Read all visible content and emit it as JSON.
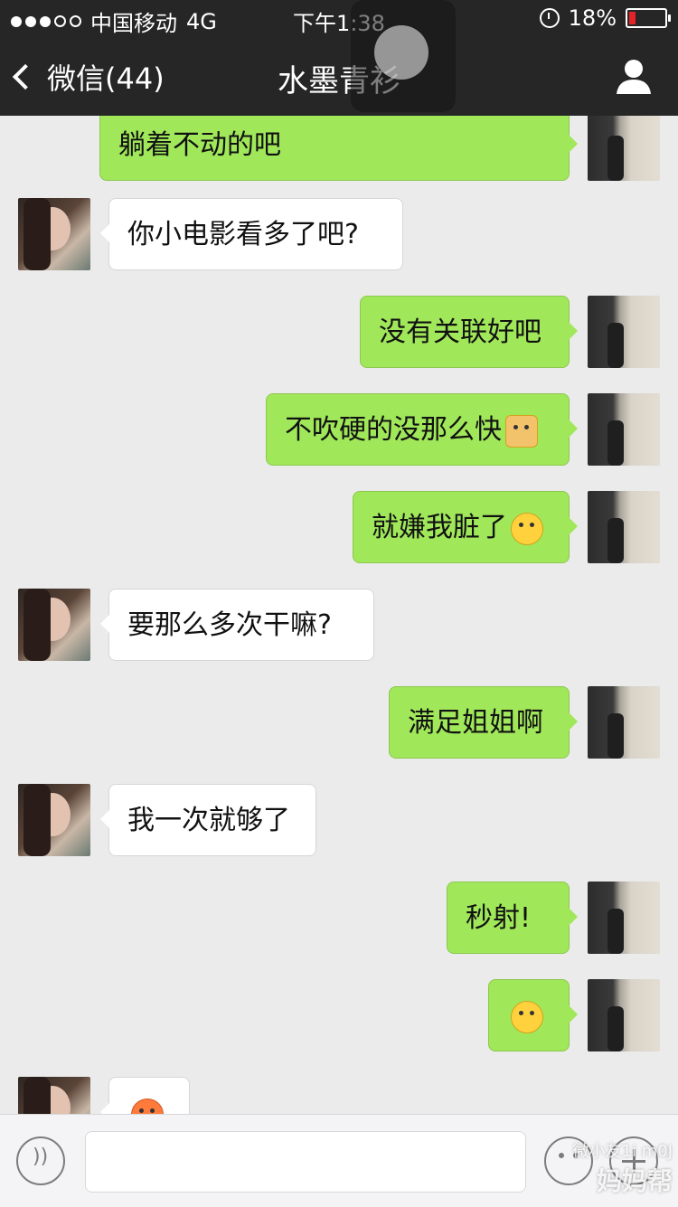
{
  "status_bar": {
    "carrier": "中国移动",
    "network": "4G",
    "time": "下午1:38",
    "battery": "18%",
    "battery_level": 0.18,
    "battery_color": "#e5212a"
  },
  "nav": {
    "back_label": "微信(44)",
    "title": "水墨青衫",
    "profile_icon": "person-icon"
  },
  "messages": [
    {
      "side": "me",
      "text": "躺着不动的吧",
      "emoji": ""
    },
    {
      "side": "other",
      "text": "你小电影看多了吧?",
      "emoji": ""
    },
    {
      "side": "me",
      "text": "没有关联好吧",
      "emoji": ""
    },
    {
      "side": "me",
      "text": "不吹硬的没那么快",
      "emoji": "hammer-emoji"
    },
    {
      "side": "me",
      "text": "就嫌我脏了",
      "emoji": "confused-emoji"
    },
    {
      "side": "other",
      "text": "要那么多次干嘛?",
      "emoji": ""
    },
    {
      "side": "me",
      "text": "满足姐姐啊",
      "emoji": ""
    },
    {
      "side": "other",
      "text": "我一次就够了",
      "emoji": ""
    },
    {
      "side": "me",
      "text": "秒射!",
      "emoji": ""
    },
    {
      "side": "me",
      "text": "",
      "emoji": "thinking-emoji"
    },
    {
      "side": "other",
      "text": "",
      "emoji": "angry-emoji"
    }
  ],
  "input_bar": {
    "voice_icon": "voice-icon",
    "emoji_icon": "emoji-icon",
    "plus_icon": "plus-icon",
    "placeholder": ""
  },
  "watermark": {
    "line1": "微小友1i m0J",
    "line2": "妈妈帮"
  },
  "colors": {
    "bar_bg": "#262626",
    "chat_bg": "#ebebeb",
    "my_bubble": "#a0e75a",
    "other_bubble": "#ffffff"
  }
}
